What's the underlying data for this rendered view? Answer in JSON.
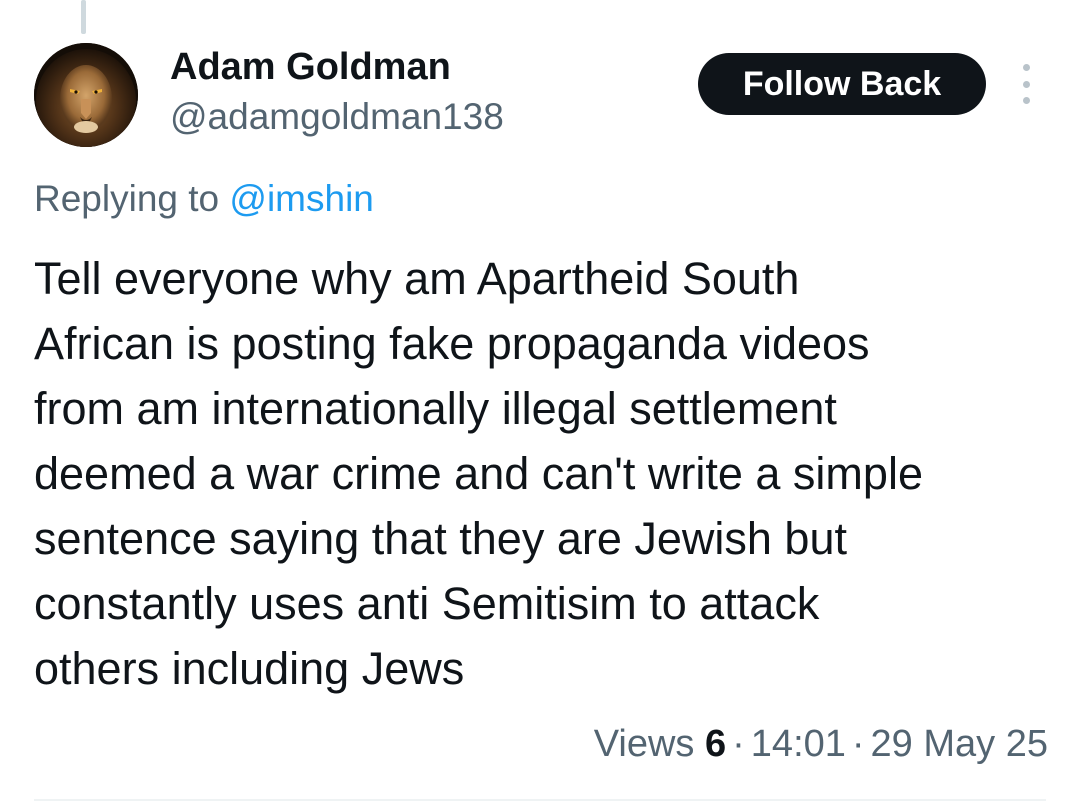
{
  "tweet": {
    "author": {
      "display_name": "Adam Goldman",
      "handle": "@adamgoldman138",
      "avatar_icon": "lion-avatar"
    },
    "follow_button_label": "Follow Back",
    "more_icon": "more-vertical-icon",
    "replying_prefix": "Replying to",
    "replying_to": "@imshin",
    "text": "Tell everyone why am Apartheid South\nAfrican is posting fake propaganda videos\nfrom am internationally illegal settlement\ndeemed a war crime and can't write a simple\nsentence saying that they are Jewish but\nconstantly uses anti Semitisim to attack\nothers including  Jews",
    "views_label": "Views",
    "views_count": "6",
    "separator": "·",
    "time": "14:01",
    "date": "29 May 25"
  },
  "colors": {
    "text_primary": "#0f1419",
    "text_secondary": "#536471",
    "link": "#1d9bf0",
    "button_bg": "#0f1419",
    "button_text": "#ffffff",
    "thread_line": "#cfd9de",
    "divider": "#eff3f4"
  }
}
